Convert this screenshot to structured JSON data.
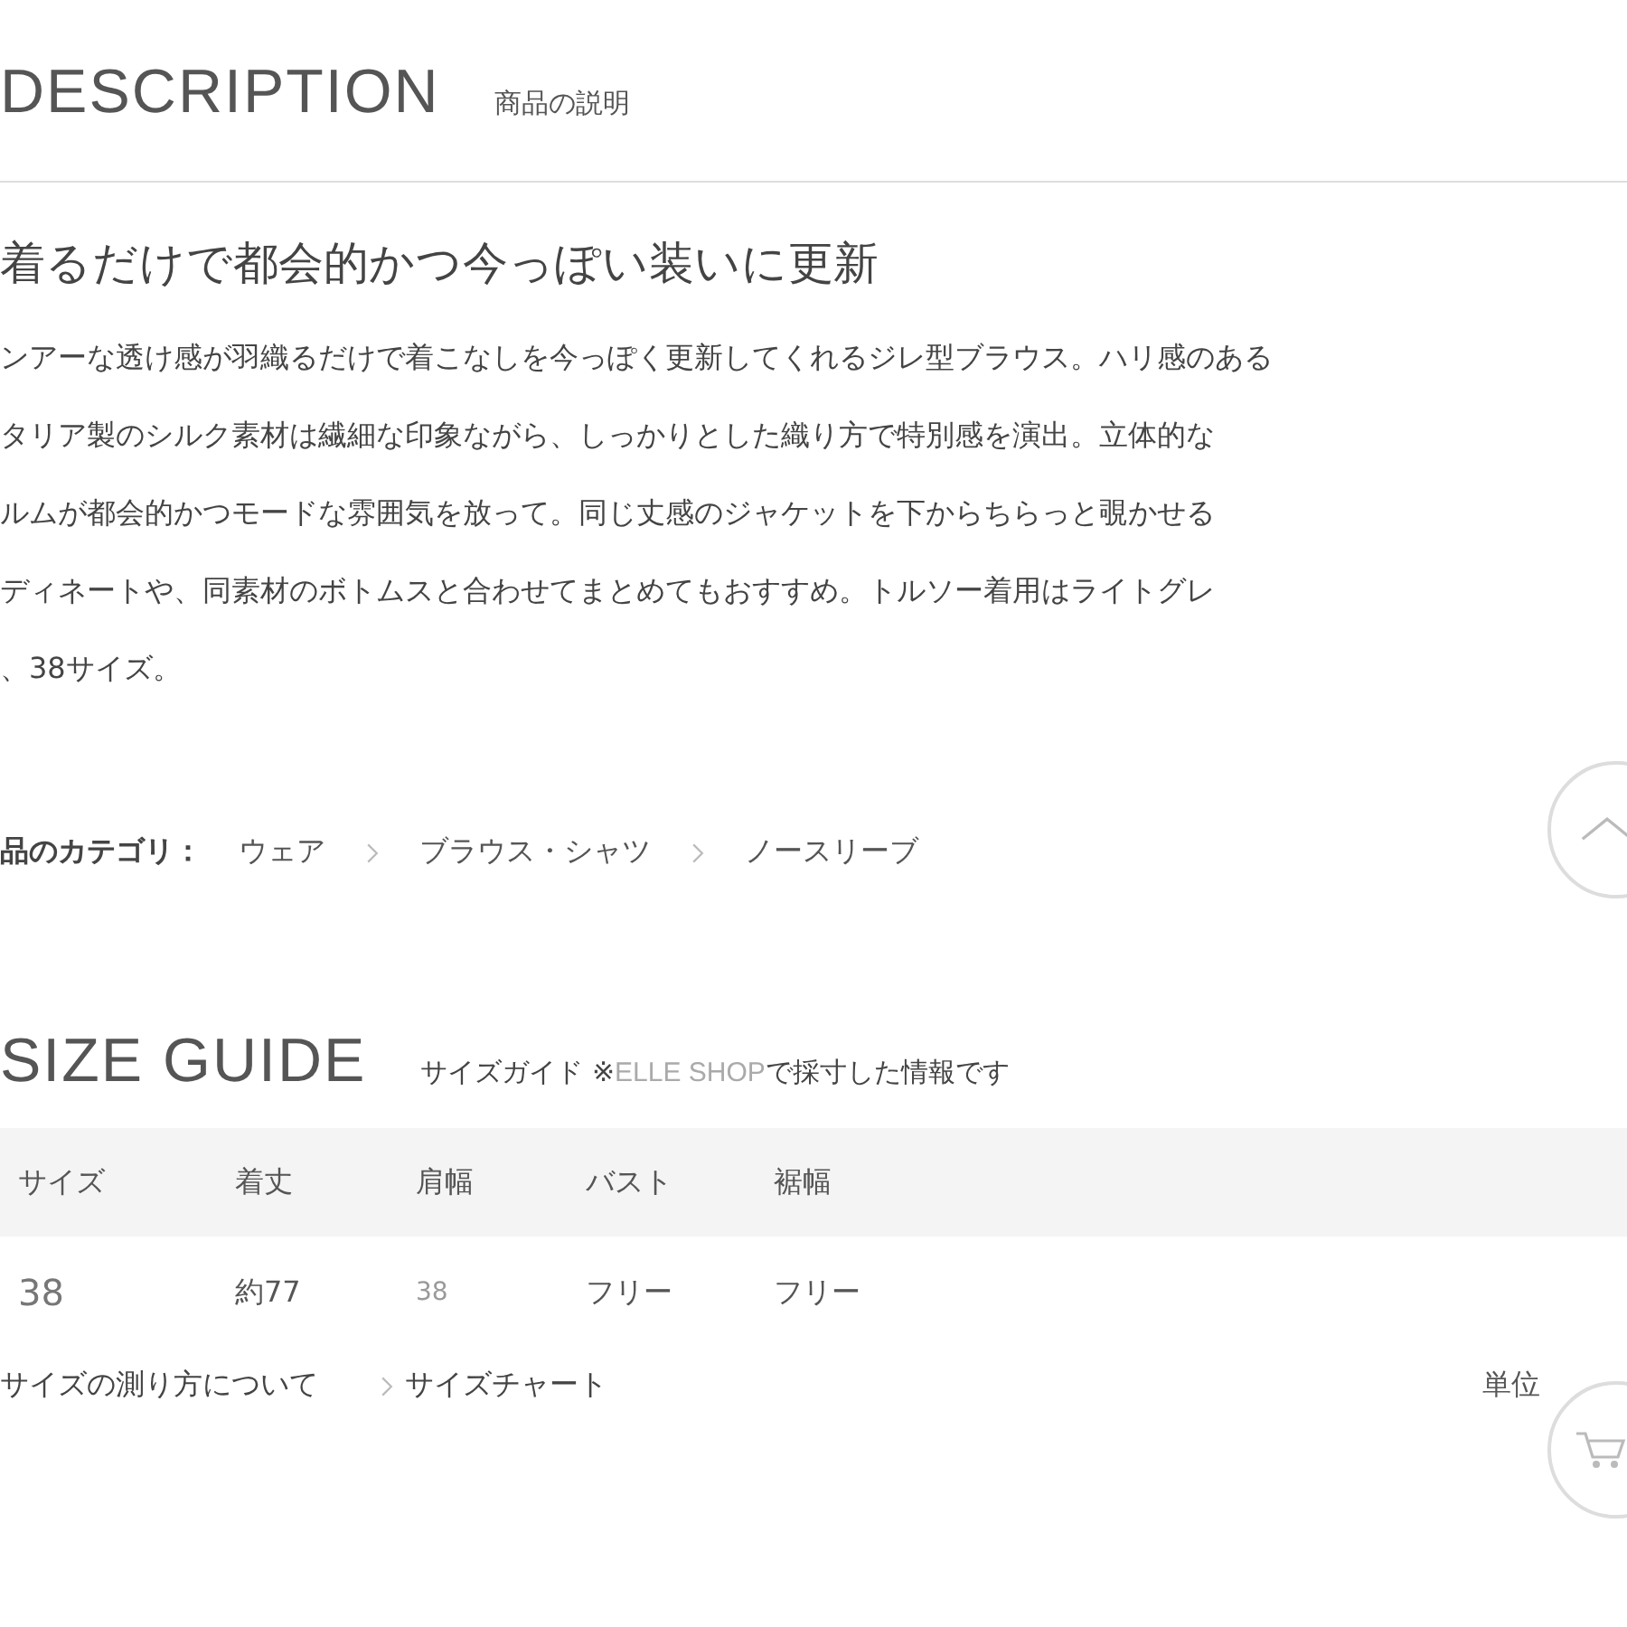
{
  "description": {
    "heading": "DESCRIPTION",
    "subheading": "商品の説明",
    "title": "着るだけで都会的かつ今っぽい装いに更新",
    "lines": [
      "ンアーな透け感が羽織るだけで着こなしを今っぽく更新してくれるジレ型ブラウス。ハリ感のある",
      "タリア製のシルク素材は繊細な印象ながら、しっかりとした織り方で特別感を演出。立体的な",
      "ルムが都会的かつモードな雰囲気を放って。同じ丈感のジャケットを下からちらっと覗かせる",
      "ディネートや、同素材のボトムスと合わせてまとめてもおすすめ。トルソー着用はライトグレ",
      "、38サイズ。"
    ]
  },
  "category": {
    "label": "品のカテゴリ：",
    "items": [
      "ウェア",
      "ブラウス・シャツ",
      "ノースリーブ"
    ]
  },
  "size_guide": {
    "heading": "SIZE GUIDE",
    "subheading": "サイズガイド ※",
    "brand": "ELLE SHOP",
    "note": "で採寸した情報です",
    "columns": [
      "サイズ",
      "着丈",
      "肩幅",
      "バスト",
      "裾幅"
    ],
    "rows": [
      [
        "38",
        "約77",
        "38",
        "フリー",
        "フリー"
      ]
    ],
    "links": [
      "サイズの測り方について",
      "サイズチャート"
    ],
    "unit": "単位"
  }
}
